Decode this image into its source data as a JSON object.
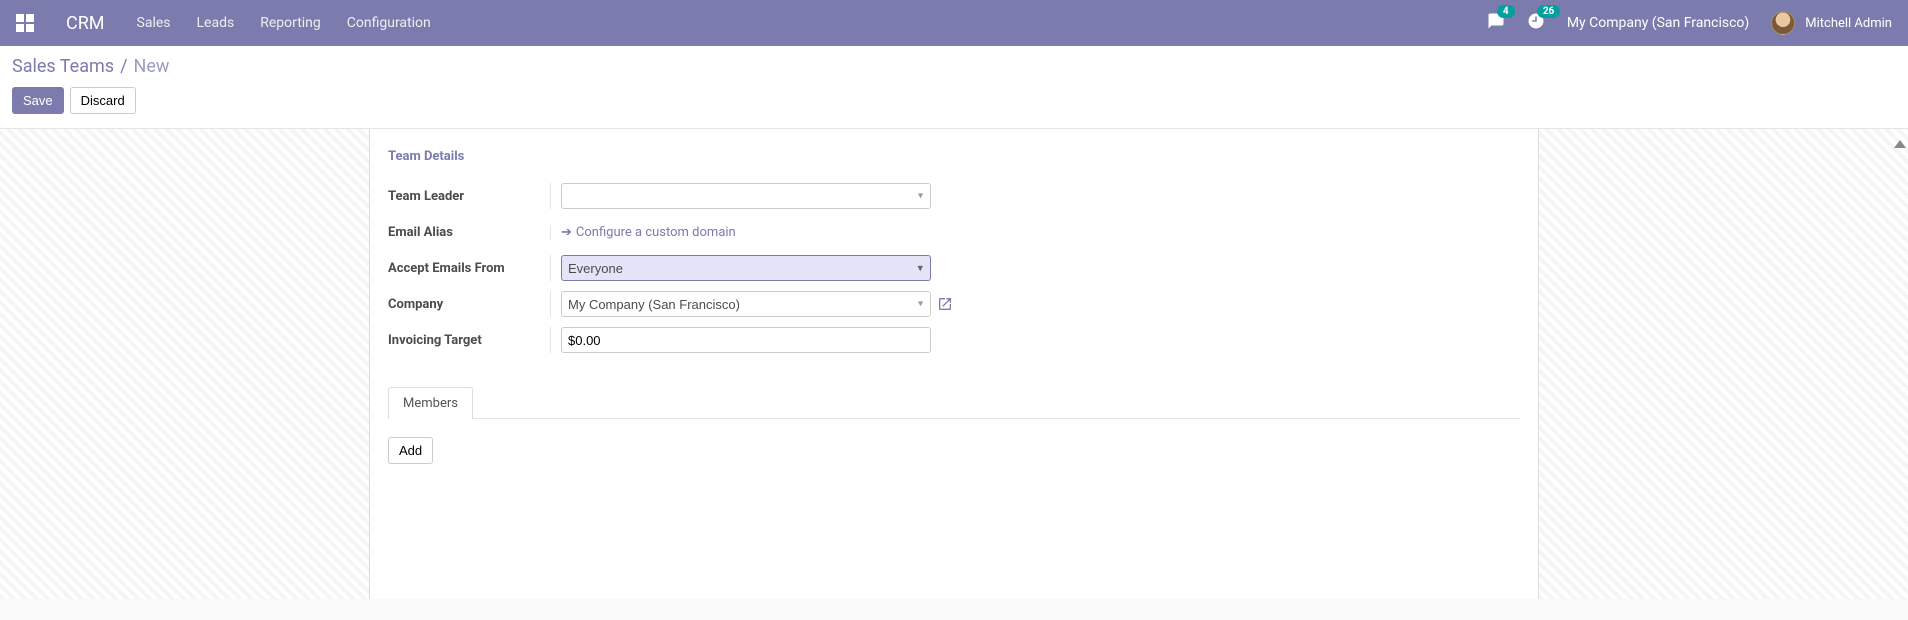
{
  "nav": {
    "brand": "CRM",
    "items": [
      "Sales",
      "Leads",
      "Reporting",
      "Configuration"
    ],
    "chat_badge": "4",
    "activity_badge": "26",
    "company": "My Company (San Francisco)",
    "user": "Mitchell Admin"
  },
  "breadcrumb": {
    "parent": "Sales Teams",
    "current": "New"
  },
  "buttons": {
    "save": "Save",
    "discard": "Discard"
  },
  "form": {
    "section_title": "Team Details",
    "labels": {
      "team_leader": "Team Leader",
      "email_alias": "Email Alias",
      "accept_emails": "Accept Emails From",
      "company": "Company",
      "invoicing_target": "Invoicing Target"
    },
    "email_alias_link": "Configure a custom domain",
    "accept_emails_value": "Everyone",
    "company_value": "My Company (San Francisco)",
    "invoicing_target_value": "$0.00"
  },
  "tabs": {
    "members": "Members"
  },
  "members": {
    "add_button": "Add"
  }
}
